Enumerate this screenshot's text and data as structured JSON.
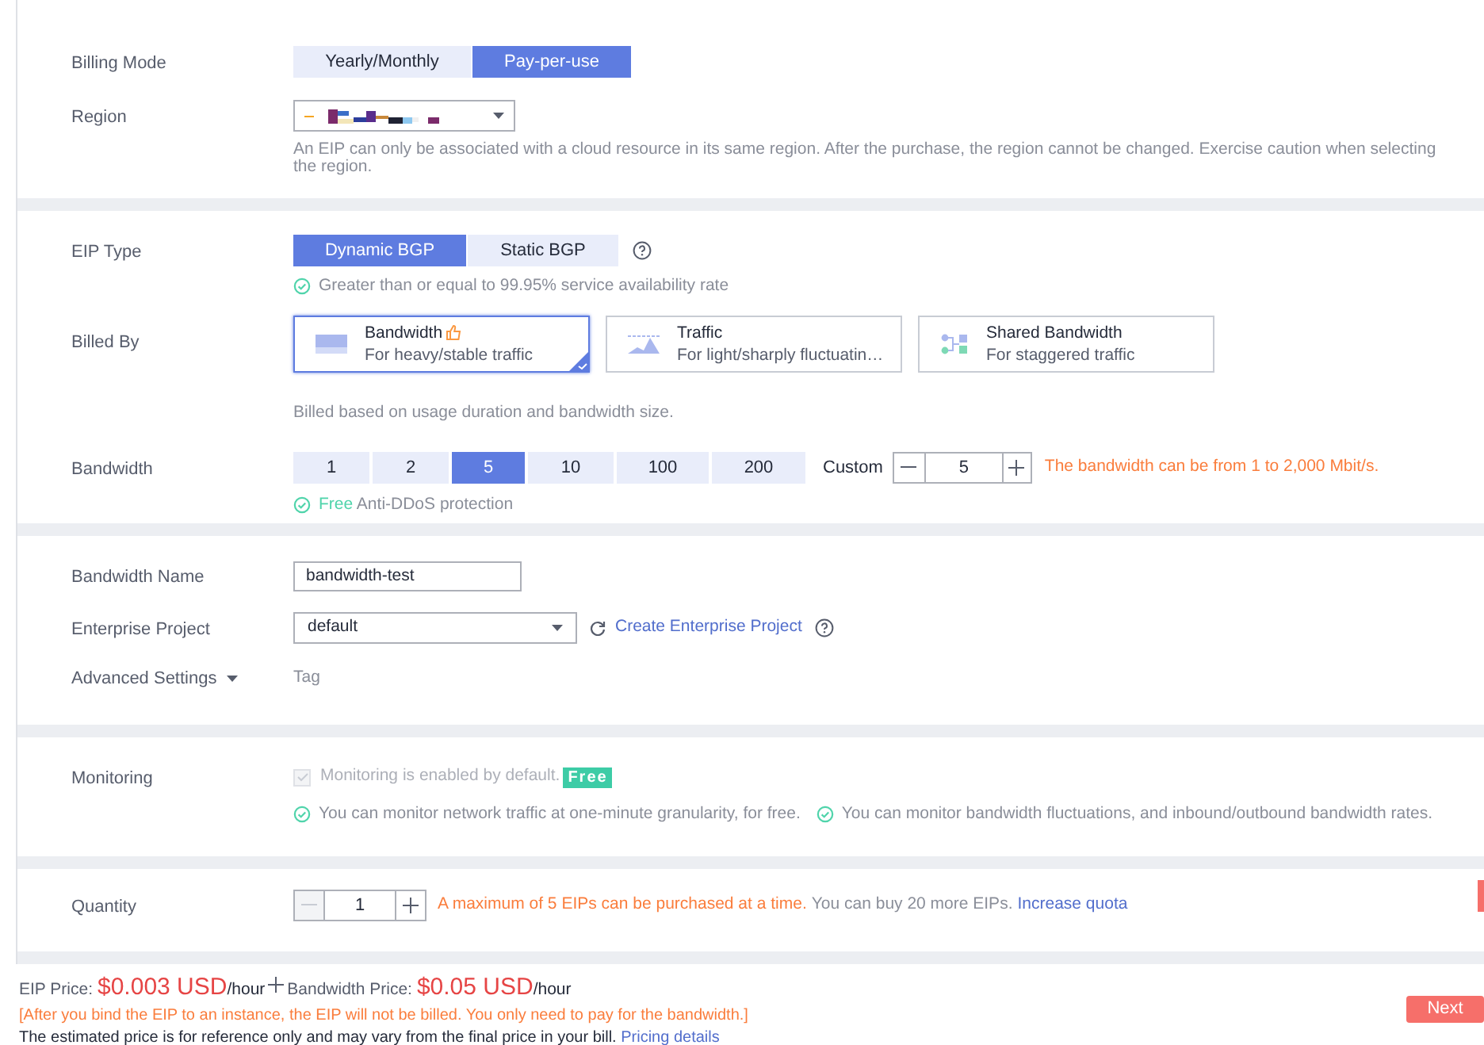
{
  "billing_mode": {
    "label": "Billing Mode",
    "options": [
      {
        "label": "Yearly/Monthly",
        "selected": false
      },
      {
        "label": "Pay-per-use",
        "selected": true
      }
    ]
  },
  "region": {
    "label": "Region",
    "note": "An EIP can only be associated with a cloud resource in its same region. After the purchase, the region cannot be changed. Exercise caution when selecting the region."
  },
  "eip_type": {
    "label": "EIP Type",
    "options": [
      {
        "label": "Dynamic BGP",
        "selected": true
      },
      {
        "label": "Static BGP",
        "selected": false
      }
    ],
    "note": "Greater than or equal to 99.95% service availability rate"
  },
  "billed_by": {
    "label": "Billed By",
    "options": [
      {
        "kind": "bandwidth",
        "title": "Bandwidth",
        "subtitle": "For heavy/stable traffic",
        "recommended": true,
        "selected": true
      },
      {
        "kind": "traffic",
        "title": "Traffic",
        "subtitle": "For light/sharply fluctuatin…",
        "recommended": false,
        "selected": false
      },
      {
        "kind": "shared",
        "title": "Shared Bandwidth",
        "subtitle": "For staggered traffic",
        "recommended": false,
        "selected": false
      }
    ],
    "note": "Billed based on usage duration and bandwidth size."
  },
  "bandwidth": {
    "label": "Bandwidth",
    "options": [
      {
        "label": "1",
        "selected": false
      },
      {
        "label": "2",
        "selected": false
      },
      {
        "label": "5",
        "selected": true
      },
      {
        "label": "10",
        "selected": false
      },
      {
        "label": "100",
        "selected": false
      },
      {
        "label": "200",
        "selected": false
      }
    ],
    "custom_label": "Custom",
    "custom_value": "5",
    "hint": "The bandwidth can be from 1 to 2,000 Mbit/s.",
    "free_word": "Free",
    "free_note": "Anti-DDoS protection"
  },
  "bandwidth_name": {
    "label": "Bandwidth Name",
    "value": "bandwidth-test"
  },
  "enterprise_project": {
    "label": "Enterprise Project",
    "value": "default",
    "link": "Create Enterprise Project"
  },
  "advanced_settings": {
    "label": "Advanced Settings",
    "expanded": false,
    "summary": "Tag"
  },
  "monitoring": {
    "label": "Monitoring",
    "checked": true,
    "disabled": true,
    "text": "Monitoring is enabled by default.",
    "badge": "Free",
    "notes": [
      "You can monitor network traffic at one-minute granularity, for free.",
      "You can monitor bandwidth fluctuations, and inbound/outbound bandwidth rates."
    ]
  },
  "quantity": {
    "label": "Quantity",
    "value": "1",
    "minus_disabled": true,
    "limit": "A maximum of 5 EIPs can be purchased at a time.",
    "remaining": "You can buy 20 more EIPs.",
    "link": "Increase quota"
  },
  "price": {
    "eip_label": "EIP Price:",
    "eip_amount": "$0.003 USD",
    "eip_unit": "/hour",
    "bandwidth_label": "Bandwidth Price:",
    "bandwidth_amount": "$0.05 USD",
    "bandwidth_unit": "/hour"
  },
  "notice": "[After you bind the EIP to an instance, the EIP will not be billed. You only need to pay for the bandwidth.]",
  "disclaimer": "The estimated price is for reference only and may vary from the final price in your bill.",
  "pricing_link": "Pricing details",
  "next_button": "Next"
}
